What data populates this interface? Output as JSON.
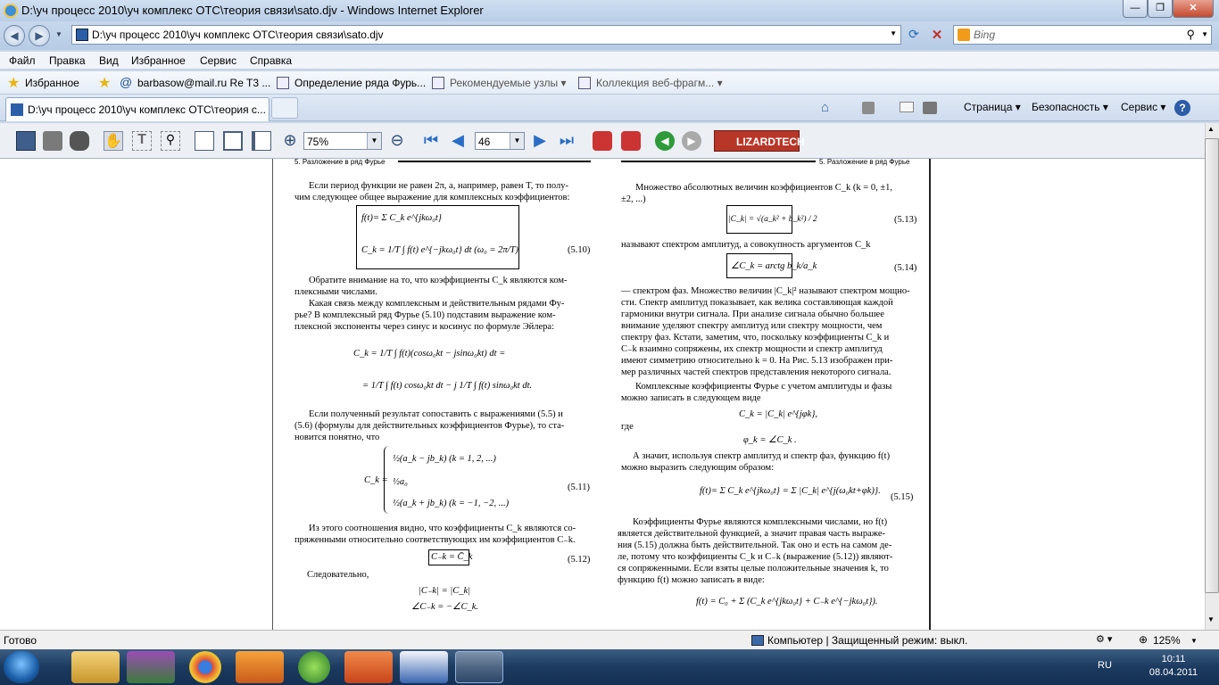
{
  "window": {
    "title": "D:\\уч процесс 2010\\уч комплекс ОТС\\теория связи\\sato.djv - Windows Internet Explorer",
    "min_label": "—",
    "max_label": "❐",
    "close_label": "✕"
  },
  "address": {
    "url": "D:\\уч процесс 2010\\уч комплекс ОТС\\теория связи\\sato.djv",
    "search_placeholder": "Bing"
  },
  "menu": [
    "Файл",
    "Правка",
    "Вид",
    "Избранное",
    "Сервис",
    "Справка"
  ],
  "favorites": {
    "label": "Избранное",
    "items": [
      "barbasow@mail.ru Re T3 ...",
      "Определение ряда Фурь...",
      "Рекомендуемые узлы ▾",
      "Коллекция веб-фрагм... ▾"
    ]
  },
  "tab": {
    "label": "D:\\уч процесс 2010\\уч комплекс ОТС\\теория с..."
  },
  "commandbar": {
    "page": "Страница ▾",
    "safety": "Безопасность ▾",
    "tools": "Сервис ▾",
    "help": "?"
  },
  "djvu": {
    "zoom": "75%",
    "page": "46",
    "brand": "LIZARDTECH"
  },
  "document": {
    "left_header": "5. Разложение в ряд Фурье",
    "right_header": "5. Разложение в ряд Фурье",
    "left": [
      "Если период функции не равен 2π, а, например, равен T, то полу-",
      "чим следующее общее выражение для комплексных коэффициентов:",
      "f(t)= Σ C_k e^{jkω₀t}",
      "C_k = 1/T ∫ f(t) e^{−jkω₀t} dt    (ω₀ = 2π/T)",
      "(5.10)",
      "Обратите внимание на то, что коэффициенты C_k являются ком-",
      "плексными числами.",
      "Какая связь между комплексным и действительным рядами Фу-",
      "рье? В комплексный ряд Фурье (5.10) подставим выражение ком-",
      "плексной экспоненты через синус и косинус по формуле Эйлера:",
      "C_k = 1/T ∫ f(t)(cosω₀kt − jsinω₀kt) dt =",
      "= 1/T ∫ f(t) cosω₀kt dt − j 1/T ∫ f(t) sinω₀kt dt.",
      "Если полученный результат сопоставить с выражениями (5.5) и",
      "(5.6) (формулы для действительных коэффициентов Фурье), то ста-",
      "новится понятно, что",
      "½(a_k − jb_k)      (k = 1, 2, ...)",
      "C_k =",
      "½a₀",
      "½(a_k + jb_k)    (k = −1, −2, ...)",
      "(5.11)",
      "Из этого соотношения видно, что коэффициенты C_k являются со-",
      "пряженными относительно соответствующих им коэффициентов C₋k.",
      "C₋k = C̄_k",
      "(5.12)",
      "Следовательно,",
      "|C₋k| = |C_k|",
      "∠C₋k = −∠C_k."
    ],
    "right": [
      "Множество абсолютных величин коэффициентов C_k (k = 0, ±1,",
      "±2, ...)",
      "|C_k| = √(a_k² + b_k²) / 2",
      "(5.13)",
      "называют спектром амплитуд, а совокупность аргументов C_k",
      "∠C_k = arctg b_k/a_k",
      "(5.14)",
      "— спектром фаз. Множество величин |C_k|² называют спектром мощно-",
      "сти. Спектр амплитуд показывает, как велика составляющая каждой",
      "гармоники внутри сигнала. При анализе сигнала обычно большее",
      "внимание уделяют спектру амплитуд или спектру мощности, чем",
      "спектру фаз. Кстати, заметим, что, поскольку коэффициенты C_k и",
      "C₋k взаимно сопряжены, их спектр мощности и спектр амплитуд",
      "имеют симметрию относительно k = 0. На Рис. 5.13 изображен при-",
      "мер различных частей спектров представления некоторого сигнала.",
      "Комплексные коэффициенты Фурье с учетом амплитуды и фазы",
      "можно записать в следующем виде",
      "C_k = |C_k| e^{jφk},",
      "где",
      "φ_k = ∠C_k .",
      "А значит, используя спектр амплитуд и спектр фаз, функцию f(t)",
      "можно выразить следующим образом:",
      "f(t)= Σ C_k e^{jkω₀t} = Σ |C_k| e^{j(ω₀kt+φk)}.",
      "(5.15)",
      "Коэффициенты Фурье являются комплексными числами, но f(t)",
      "является действительной функцией, а значит правая часть выраже-",
      "ния (5.15) должна быть действительной. Так оно и есть на самом де-",
      "ле, потому что коэффициенты C_k и C₋k (выражение (5.12)) являют-",
      "ся сопряженными. Если взяты целые положительные значения k, то",
      "функцию f(t) можно записать в виде:",
      "f(t) = C₀ + Σ (C_k e^{jkω₀t} + C₋k e^{−jkω₀t})."
    ]
  },
  "status": {
    "text": "Готово",
    "zone": "Компьютер | Защищенный режим: выкл.",
    "zoom": "125%"
  },
  "taskbar": {
    "lang": "RU",
    "time": "10:11",
    "date": "08.04.2011"
  }
}
